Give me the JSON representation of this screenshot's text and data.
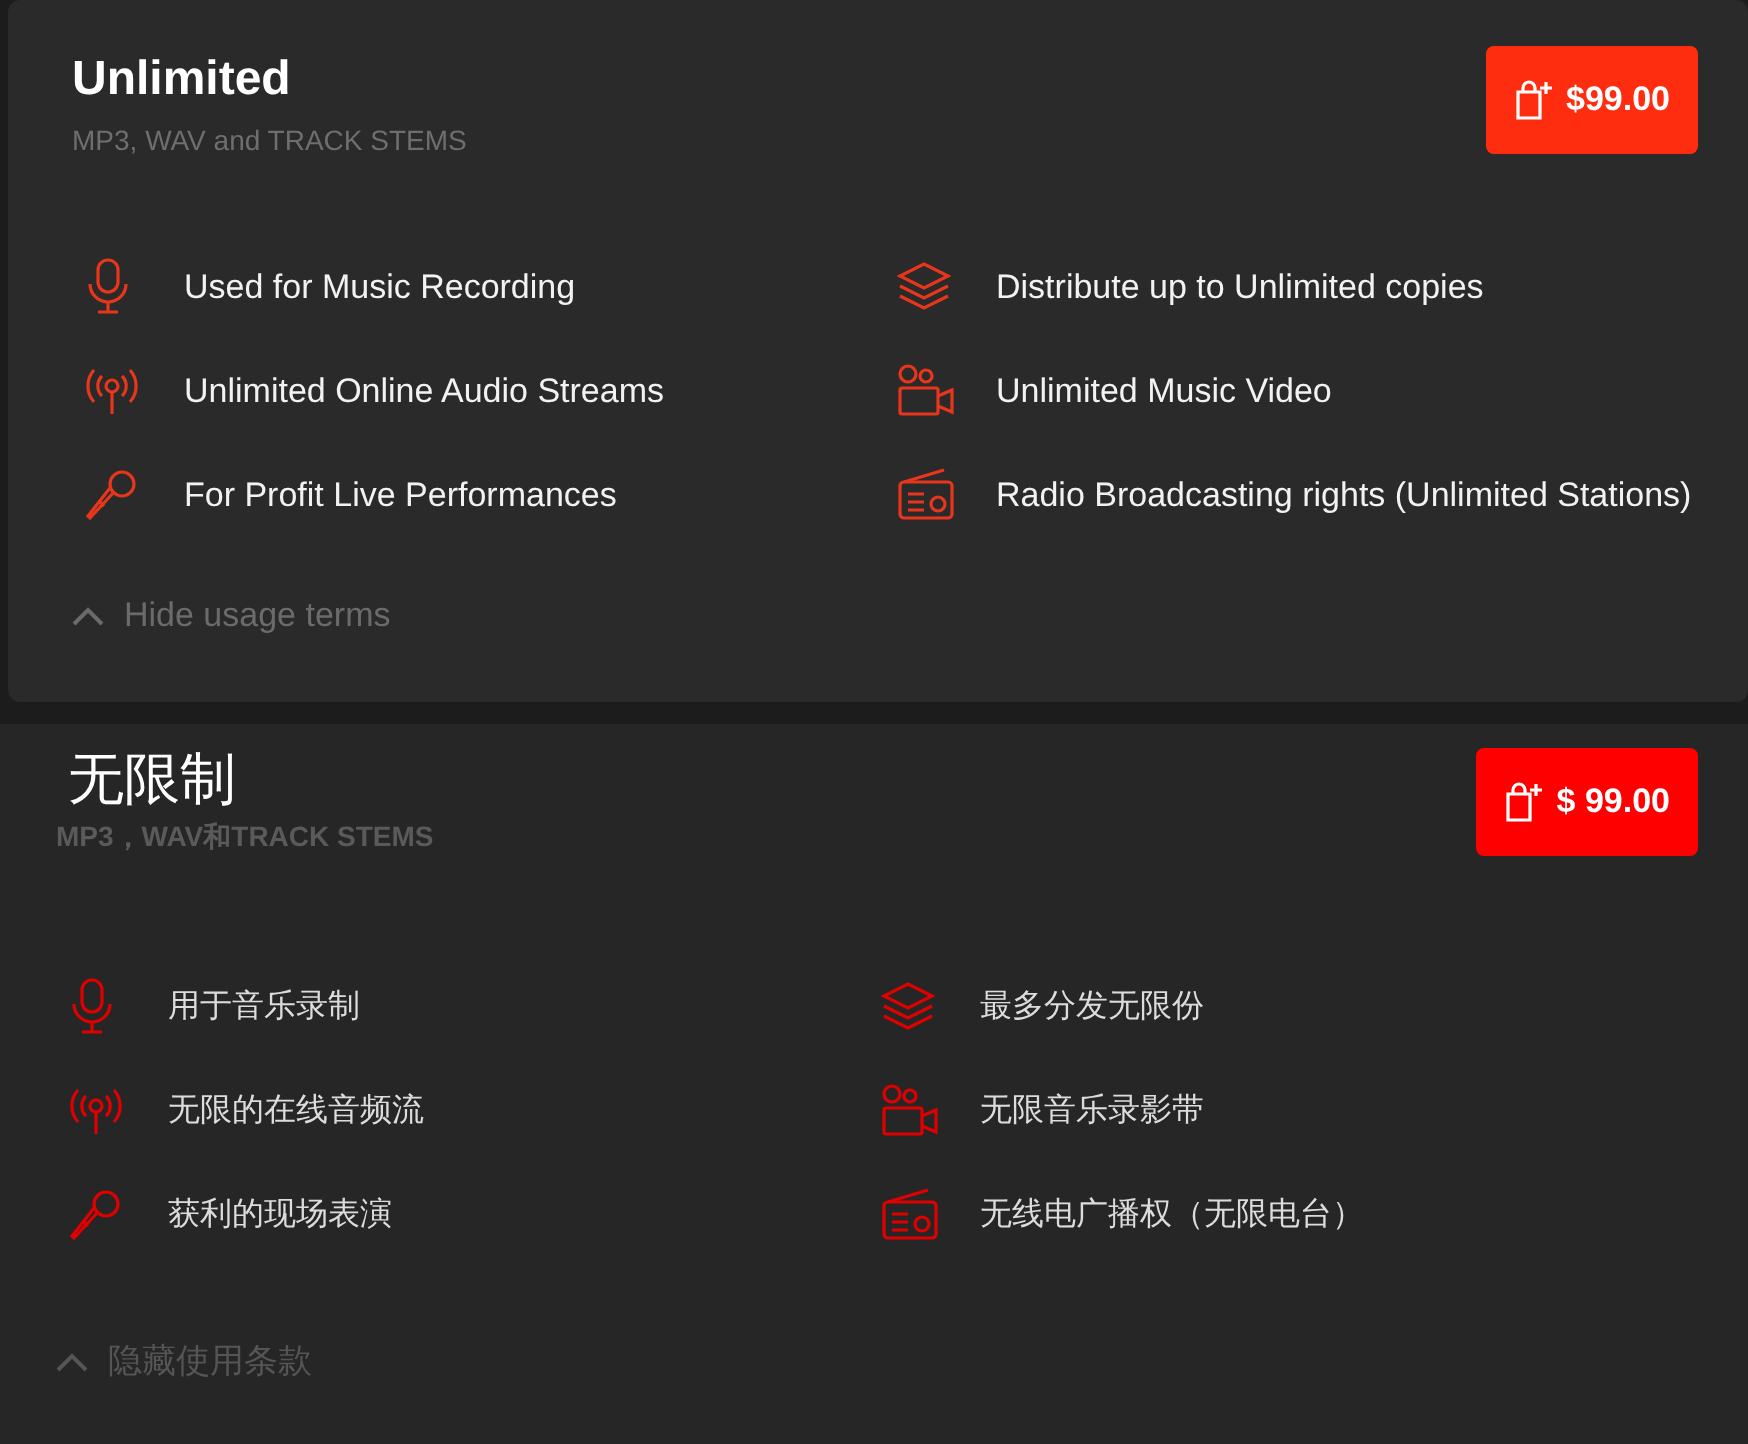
{
  "sections": [
    {
      "title": "Unlimited",
      "subtitle": "MP3, WAV and TRACK STEMS",
      "price_button": "$99.00",
      "features_left": [
        "Used for Music Recording",
        "Unlimited Online Audio Streams",
        "For Profit Live Performances"
      ],
      "features_right": [
        "Distribute up to Unlimited copies",
        "Unlimited Music Video",
        "Radio Broadcasting rights (Unlimited Stations)"
      ],
      "toggle": "Hide usage terms"
    },
    {
      "title": "无限制",
      "subtitle": "MP3，WAV和TRACK STEMS",
      "price_button": "$ 99.00",
      "features_left": [
        "用于音乐录制",
        "无限的在线音频流",
        "获利的现场表演"
      ],
      "features_right": [
        "最多分发无限份",
        "无限音乐录影带",
        "无线电广播权（无限电台）"
      ],
      "toggle": "隐藏使用条款"
    }
  ]
}
